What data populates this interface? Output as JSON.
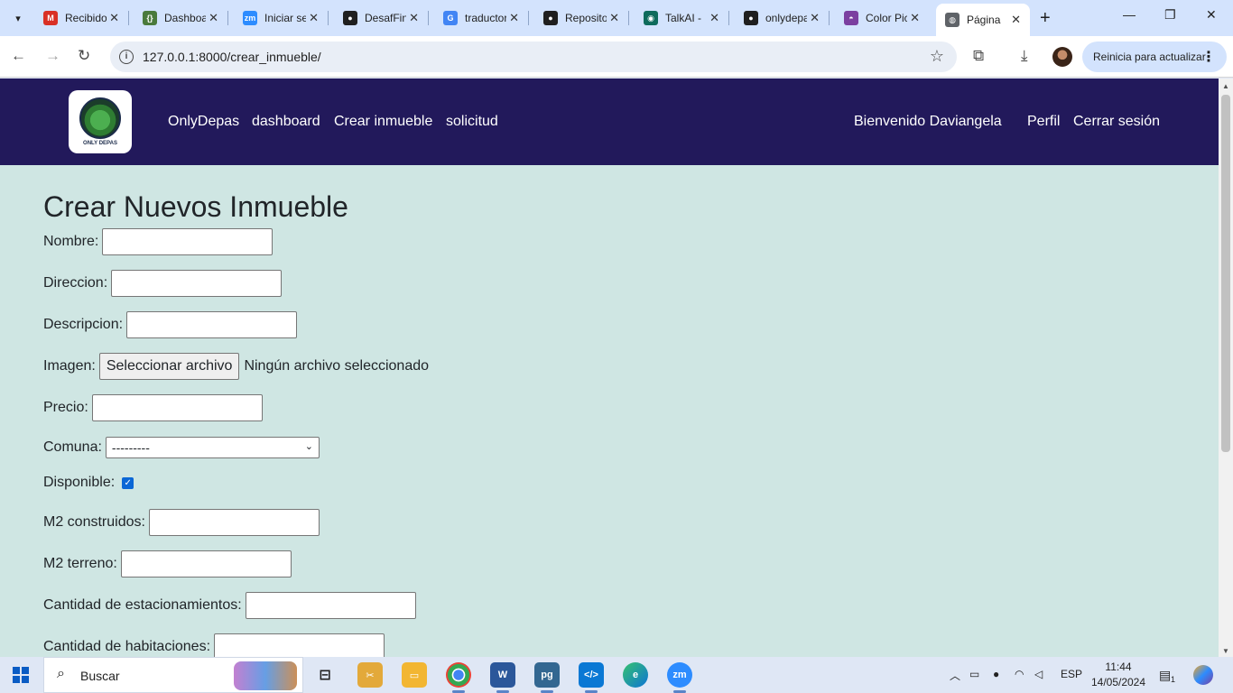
{
  "browser": {
    "tabs": [
      {
        "title": "Recibidos",
        "icon": "gmail-icon",
        "color": "#d93025",
        "glyph": "M"
      },
      {
        "title": "Dashboard",
        "icon": "dashboard-icon",
        "color": "#4a7a3c",
        "glyph": "{}"
      },
      {
        "title": "Iniciar sesión",
        "icon": "zoom-icon",
        "color": "#2d8cff",
        "glyph": "zm"
      },
      {
        "title": "DesafFinal",
        "icon": "github-icon",
        "color": "#1f1f1f",
        "glyph": "●"
      },
      {
        "title": "traductor",
        "icon": "google-icon",
        "color": "#4285f4",
        "glyph": "G"
      },
      {
        "title": "Repositorios",
        "icon": "github-icon",
        "color": "#1f1f1f",
        "glyph": "●"
      },
      {
        "title": "TalkAI -",
        "icon": "talkai-icon",
        "color": "#0e6b5c",
        "glyph": "◉"
      },
      {
        "title": "onlydepas",
        "icon": "github-icon",
        "color": "#1f1f1f",
        "glyph": "●"
      },
      {
        "title": "Color Picker",
        "icon": "colorpicker-icon",
        "color": "#7b3fa0",
        "glyph": "◓"
      },
      {
        "title": "Página",
        "icon": "globe-icon",
        "color": "#5f6368",
        "glyph": "◍"
      }
    ],
    "url": "127.0.0.1:8000/crear_inmueble/",
    "update_label": "Reinicia para actualizar"
  },
  "navbar": {
    "logo_text": "ONLY DEPAS",
    "links": [
      "OnlyDepas",
      "dashboard",
      "Crear inmueble",
      "solicitud"
    ],
    "welcome": "Bienvenido Daviangela",
    "profile": "Perfil",
    "logout": "Cerrar sesión"
  },
  "form": {
    "title": "Crear Nuevos Inmueble",
    "nombre_label": "Nombre:",
    "direccion_label": "Direccion:",
    "descripcion_label": "Descripcion:",
    "imagen_label": "Imagen:",
    "file_button": "Seleccionar archivo",
    "file_status": "Ningún archivo seleccionado",
    "precio_label": "Precio:",
    "comuna_label": "Comuna:",
    "comuna_value": "---------",
    "disponible_label": "Disponible:",
    "disponible_checked": true,
    "m2_construidos_label": "M2 construidos:",
    "m2_terreno_label": "M2 terreno:",
    "estacionamientos_label": "Cantidad de estacionamientos:",
    "habitaciones_label": "Cantidad de habitaciones:"
  },
  "taskbar": {
    "search_label": "Buscar",
    "language": "ESP",
    "time": "11:44",
    "date": "14/05/2024",
    "notification_count": "1"
  }
}
